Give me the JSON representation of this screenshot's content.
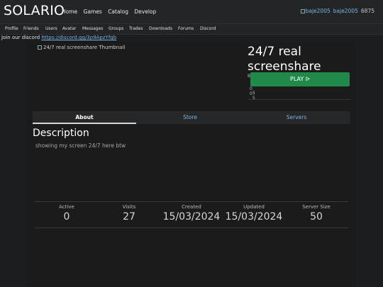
{
  "brand": "SOLARIO",
  "nav": {
    "items": [
      "Home",
      "Games",
      "Catalog",
      "Develop"
    ]
  },
  "user": {
    "avatar_alt": "baje2005",
    "username": "baje2005",
    "robux": "6875"
  },
  "subnav": {
    "items": [
      "Profile",
      "Friends",
      "Users",
      "Avatar",
      "Messages",
      "Groups",
      "Trades",
      "Downloads",
      "Forums",
      "Discord"
    ]
  },
  "banner": {
    "text": "Join our discord",
    "link": "https://discord.gg/3p9ApzYfqb"
  },
  "game": {
    "thumbnail_alt": "24/7 real screenshare Thumbnail",
    "title": "24/7 real screenshare",
    "by_prefix": "B",
    "play_label": "PLAY ᐅ",
    "meta_a": [
      "0",
      "5"
    ],
    "meta_b": [
      "0",
      "5"
    ]
  },
  "tabs": {
    "about": "About",
    "store": "Store",
    "servers": "Servers"
  },
  "description": {
    "heading": "Description",
    "text": "showing my screen 24/7 here btw"
  },
  "stats": [
    {
      "label": "Active",
      "value": "0"
    },
    {
      "label": "Visits",
      "value": "27"
    },
    {
      "label": "Created",
      "value": "15/03/2024"
    },
    {
      "label": "Updated",
      "value": "15/03/2024"
    },
    {
      "label": "Server Size",
      "value": "50"
    }
  ],
  "colors": {
    "background": "#1c1d1f",
    "accent_link": "#7fb3e8",
    "play_button": "#218a4a"
  }
}
